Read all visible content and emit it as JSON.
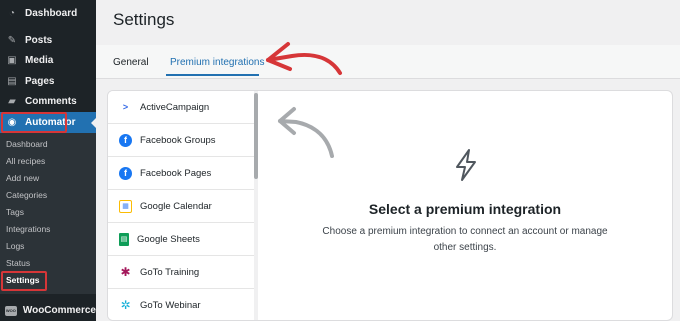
{
  "sidebar": {
    "items": [
      {
        "label": "Dashboard",
        "icon": "dashboard-icon",
        "glyph": "◔"
      },
      {
        "label": "Posts",
        "icon": "pin-icon",
        "glyph": "✎"
      },
      {
        "label": "Media",
        "icon": "media-icon",
        "glyph": "▣"
      },
      {
        "label": "Pages",
        "icon": "page-icon",
        "glyph": "▤"
      },
      {
        "label": "Comments",
        "icon": "comment-icon",
        "glyph": "▰"
      },
      {
        "label": "Automator",
        "icon": "automator-icon",
        "glyph": "◉"
      }
    ],
    "submenu": [
      "Dashboard",
      "All recipes",
      "Add new",
      "Categories",
      "Tags",
      "Integrations",
      "Logs",
      "Status",
      "Settings"
    ],
    "woocommerce": {
      "label": "WooCommerce",
      "badge": "WOO"
    }
  },
  "header": {
    "title": "Settings"
  },
  "tabs": [
    {
      "label": "General"
    },
    {
      "label": "Premium integrations"
    }
  ],
  "integrations": [
    {
      "label": "ActiveCampaign",
      "icon": "activecampaign-icon",
      "glyph": ">",
      "color": "#356ae6"
    },
    {
      "label": "Facebook Groups",
      "icon": "facebook-icon",
      "glyph": "f",
      "color": "#1877f2"
    },
    {
      "label": "Facebook Pages",
      "icon": "facebook-icon",
      "glyph": "f",
      "color": "#1877f2"
    },
    {
      "label": "Google Calendar",
      "icon": "google-calendar-icon",
      "glyph": "▦",
      "color": "#4285f4"
    },
    {
      "label": "Google Sheets",
      "icon": "google-sheets-icon",
      "glyph": "▤",
      "color": "#0f9d58"
    },
    {
      "label": "GoTo Training",
      "icon": "goto-training-icon",
      "glyph": "✱",
      "color": "#a4185b"
    },
    {
      "label": "GoTo Webinar",
      "icon": "goto-webinar-icon",
      "glyph": "✲",
      "color": "#15b0d8"
    }
  ],
  "empty_state": {
    "icon": "lightning-icon",
    "title": "Select a premium integration",
    "description": "Choose a premium integration to connect an account or manage other settings."
  },
  "colors": {
    "accent": "#2271b1",
    "sidebar": "#1d2327",
    "annotation": "#d63638"
  }
}
